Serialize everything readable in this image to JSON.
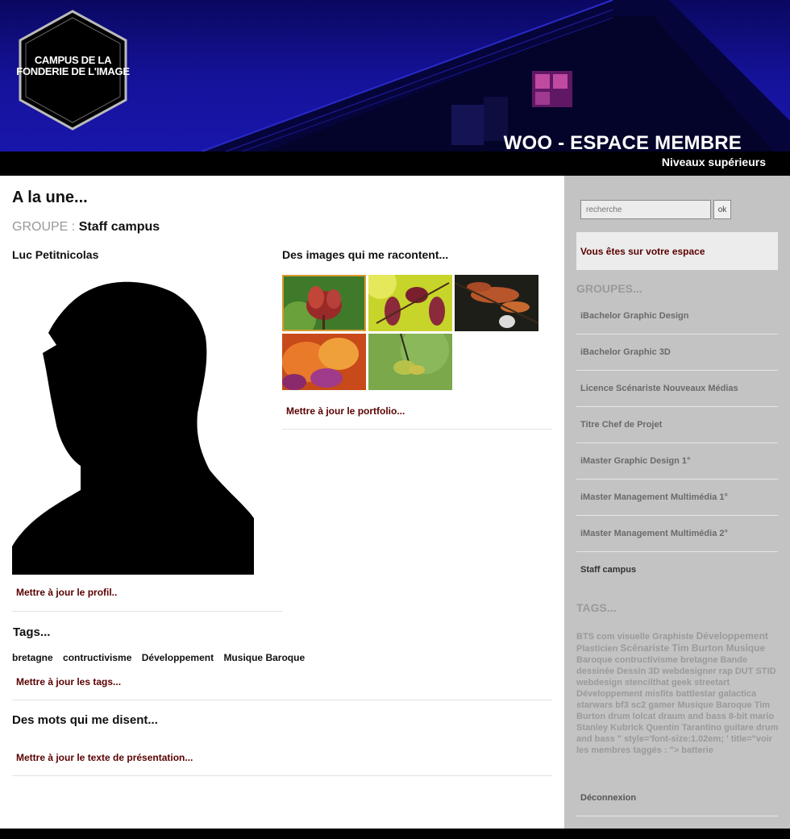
{
  "header": {
    "logo_line1": "CAMPUS DE LA",
    "logo_line2": "FONDERIE DE L'IMAGE",
    "title": "WOO - ESPACE MEMBRE",
    "subtitle": "Niveaux supérieurs"
  },
  "main": {
    "heading": "A la une...",
    "group_label": "GROUPE :",
    "group_value": "Staff campus",
    "user_name": "Luc Petitnicolas",
    "profile_link": "Mettre à jour le profil..",
    "images_title": "Des images qui me racontent...",
    "portfolio_link": "Mettre à jour le portfolio...",
    "tags_title": "Tags...",
    "tags": [
      "bretagne",
      "contructivisme",
      "Développement",
      "Musique Baroque"
    ],
    "tags_link": "Mettre à jour les tags...",
    "mots_title": "Des mots qui me disent...",
    "texte_link": "Mettre à jour le texte de présentation..."
  },
  "sidebar": {
    "search_placeholder": "recherche",
    "search_button": "ok",
    "space_text": "Vous êtes sur votre espace",
    "groups_heading": "GROUPES...",
    "groups": [
      "iBachelor Graphic Design",
      "iBachelor Graphic 3D",
      "Licence Scénariste Nouveaux Médias",
      "Titre Chef de Projet",
      "iMaster Graphic Design 1°",
      "iMaster Management Multimédia 1°",
      "iMaster Management Multimédia 2°",
      "Staff campus"
    ],
    "tags_heading": "TAGS...",
    "tag_cloud_a": "BTS com visuelle Graphiste",
    "tag_cloud_b": "Développement",
    "tag_cloud_c": "Plasticien",
    "tag_cloud_d": "Scénariste Tim Burton Musique",
    "tag_cloud_e": "Baroque contructivisme bretagne Bande dessinée Dessin 3D webdesigner rap DUT STID webdesign stencilthat geek streetart Développement misfits battlestar galactica starwars bf3 sc2 gamer Musique Baroque Tim Burton drum lolcat draum and bass 8-bit mario Stanley Kubrick Quentin Tarantino guitare drum and bass \" style='font-size:1.02em; ' title=\"voir les membres taggés : \"> batterie",
    "logout": "Déconnexion"
  },
  "colors": {
    "header_sky": "#15129a",
    "link": "#5a0000",
    "sidebar_bg": "#c3c3c3",
    "muted": "#9a9a9a"
  }
}
